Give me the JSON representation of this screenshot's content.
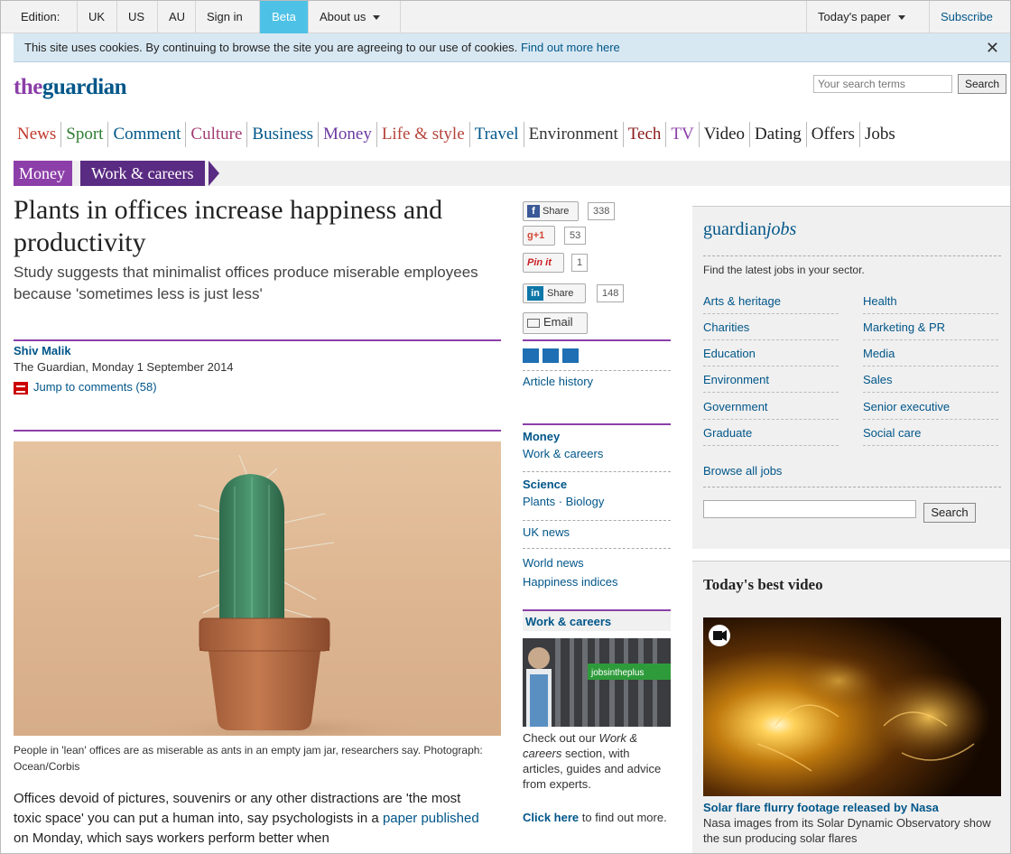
{
  "topbar": {
    "edition_label": "Edition:",
    "editions": [
      "UK",
      "US",
      "AU"
    ],
    "sign_in": "Sign in",
    "beta": "Beta",
    "about": "About us",
    "todays_paper": "Today's paper",
    "subscribe": "Subscribe"
  },
  "cookie": {
    "text": "This site uses cookies. By continuing to browse the site you are agreeing to our use of cookies.",
    "link": "Find out more here",
    "close": "✕"
  },
  "masthead": {
    "logo_the": "the",
    "logo_guardian": "guardian",
    "search_placeholder": "Your search terms",
    "search_button": "Search"
  },
  "nav": {
    "items": [
      {
        "label": "News",
        "color": "#c0392b"
      },
      {
        "label": "Sport",
        "color": "#2e7d32"
      },
      {
        "label": "Comment",
        "color": "#005689"
      },
      {
        "label": "Culture",
        "color": "#a23b72"
      },
      {
        "label": "Business",
        "color": "#005689"
      },
      {
        "label": "Money",
        "color": "#6b3aa0"
      },
      {
        "label": "Life & style",
        "color": "#b5443b"
      },
      {
        "label": "Travel",
        "color": "#005689"
      },
      {
        "label": "Environment",
        "color": "#333333"
      },
      {
        "label": "Tech",
        "color": "#8b1a1a"
      },
      {
        "label": "TV",
        "color": "#8c3fa8"
      },
      {
        "label": "Video",
        "color": "#222222"
      },
      {
        "label": "Dating",
        "color": "#222222"
      },
      {
        "label": "Offers",
        "color": "#222222"
      },
      {
        "label": "Jobs",
        "color": "#222222"
      }
    ]
  },
  "breadcrumb": {
    "section": "Money",
    "subsection": "Work & careers"
  },
  "article": {
    "headline": "Plants in offices increase happiness and productivity",
    "standfirst": "Study suggests that minimalist offices produce miserable employees because 'sometimes less is just less'",
    "author": "Shiv Malik",
    "dateline": "The Guardian, Monday 1 September 2014",
    "comments_link": "Jump to comments (58)",
    "caption": "People in 'lean' offices are as miserable as ants in an empty jam jar, researchers say. Photograph: Ocean/Corbis",
    "body_start": "Offices devoid of pictures, souvenirs or any other distractions are 'the most toxic space' you can put a human into, say psychologists in a ",
    "body_link": "paper published",
    "body_end": " on Monday, which says workers perform better when"
  },
  "share": {
    "facebook": "Share",
    "facebook_count": "338",
    "gplus": "+1",
    "gplus_count": "53",
    "pinterest": "Pin it",
    "pinterest_count": "1",
    "linkedin": "Share",
    "linkedin_count": "148",
    "email": "Email",
    "article_history": "Article history"
  },
  "related": {
    "money_head": "Money",
    "money_link": "Work & careers",
    "science_head": "Science",
    "science_links": "Plants · Biology",
    "uk_news": "UK news",
    "world_news": "World news",
    "happiness": "Happiness indices"
  },
  "promo": {
    "head": "Work & careers",
    "sign_text": "jobsintheplus",
    "text_pre": "Check out our ",
    "text_em": "Work & careers",
    "text_post": " section, with articles, guides and advice from experts.",
    "more_link": "Click here",
    "more_text": " to find out more."
  },
  "jobs": {
    "logo_main": "guardian",
    "logo_italic": "jobs",
    "subtitle": "Find the latest jobs in your sector.",
    "left": [
      "Arts & heritage",
      "Charities",
      "Education",
      "Environment",
      "Government",
      "Graduate"
    ],
    "right": [
      "Health",
      "Marketing & PR",
      "Media",
      "Sales",
      "Senior executive",
      "Social care"
    ],
    "browse": "Browse all jobs",
    "search_button": "Search"
  },
  "video": {
    "title": "Today's best video",
    "caption_link": "Solar flare flurry footage released by Nasa",
    "caption_text": "Nasa images from its Solar Dynamic Observatory show the sun producing solar flares"
  },
  "colors": {
    "brand_blue": "#005689",
    "brand_purple": "#8c3fa8",
    "beta_blue": "#4ec2e6",
    "cookie_bg": "#d8e8f2"
  }
}
